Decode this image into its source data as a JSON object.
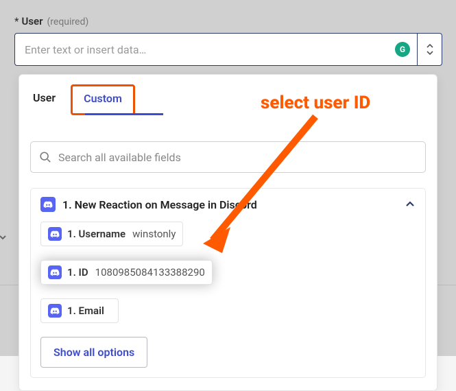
{
  "field": {
    "label": "User",
    "required_text": "(required)",
    "placeholder": "Enter text or insert data…",
    "grammarly_badge": "G"
  },
  "tabs": {
    "user": "User",
    "custom": "Custom"
  },
  "search": {
    "placeholder": "Search all available fields"
  },
  "source": {
    "title": "1. New Reaction on Message in Discord",
    "fields": [
      {
        "label": "1. Username",
        "value": "winstonly"
      },
      {
        "label": "1. ID",
        "value": "1080985084133388290"
      },
      {
        "label": "1. Email",
        "value": ""
      }
    ],
    "show_all": "Show all options"
  },
  "annotation": {
    "text": "select user ID"
  }
}
